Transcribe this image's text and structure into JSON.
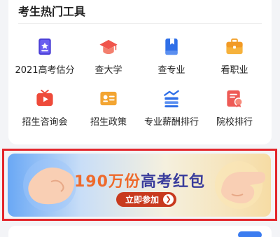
{
  "tools": {
    "title": "考生热门工具",
    "items": [
      {
        "label": "2021高考估分",
        "icon": "score-estimate-icon"
      },
      {
        "label": "查大学",
        "icon": "graduation-cap-icon"
      },
      {
        "label": "查专业",
        "icon": "bookmark-book-icon"
      },
      {
        "label": "看职业",
        "icon": "briefcase-icon"
      },
      {
        "label": "招生咨询会",
        "icon": "video-tv-icon"
      },
      {
        "label": "招生政策",
        "icon": "id-card-icon"
      },
      {
        "label": "专业薪酬排行",
        "icon": "salary-chart-icon"
      },
      {
        "label": "院校排行",
        "icon": "certificate-icon"
      }
    ]
  },
  "banner": {
    "headline_number": "190万份",
    "headline_text": "高考红包",
    "cta_label": "立即参加",
    "cta_arrow": "❯",
    "highlight_color": "#e3252b"
  }
}
